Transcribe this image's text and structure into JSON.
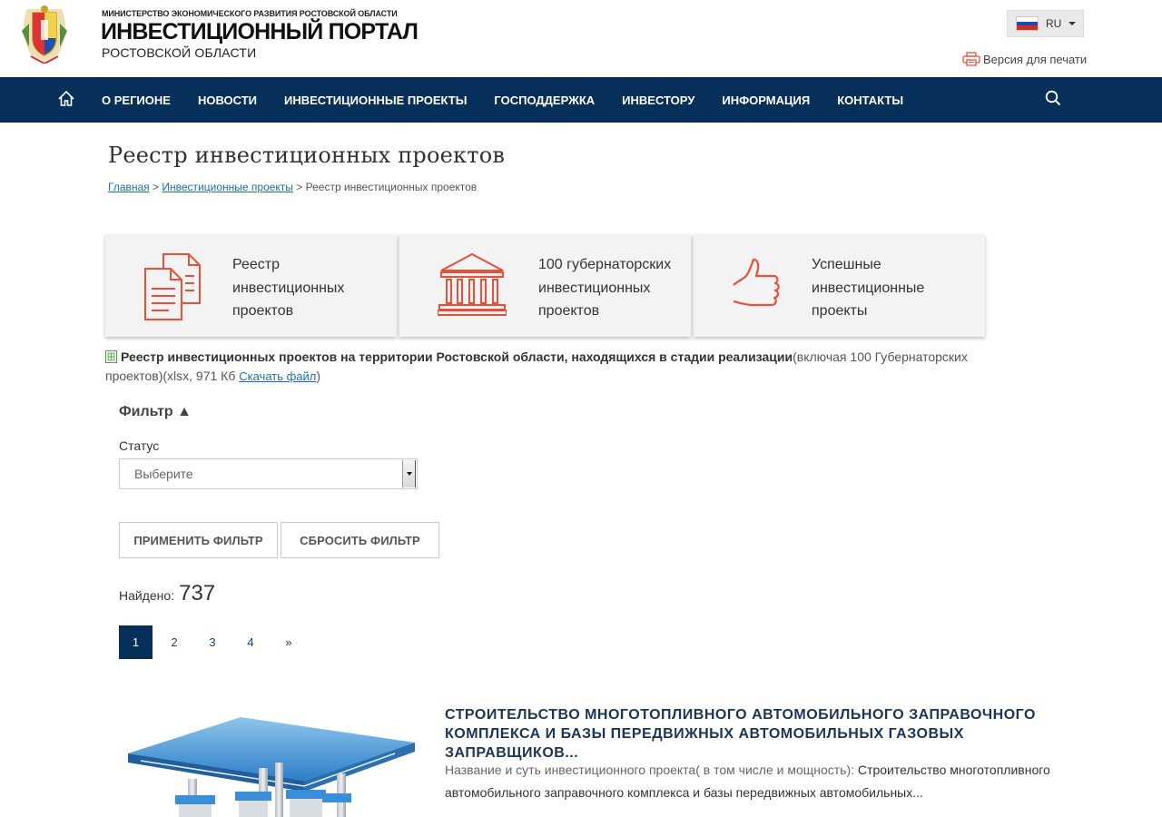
{
  "header": {
    "ministry": "МИНИСТЕРСТВО ЭКОНОМИЧЕСКОГО РАЗВИТИЯ РОСТОВСКОЙ ОБЛАСТИ",
    "title": "ИНВЕСТИЦИОННЫЙ ПОРТАЛ",
    "subtitle": "РОСТОВСКОЙ ОБЛАСТИ",
    "lang": "RU",
    "print_label": "Версия для печати"
  },
  "nav": {
    "items": [
      "О РЕГИОНЕ",
      "НОВОСТИ",
      "ИНВЕСТИЦИОННЫЕ ПРОЕКТЫ",
      "ГОСПОДДЕРЖКА",
      "ИНВЕСТОРУ",
      "ИНФОРМАЦИЯ",
      "КОНТАКТЫ"
    ]
  },
  "page": {
    "title": "Реестр инвестиционных проектов",
    "breadcrumb": {
      "home": "Главная",
      "sep1": ">",
      "section": "Инвестиционные проекты",
      "sep2": ">",
      "current": "Реестр инвестиционных проектов"
    }
  },
  "cards": [
    {
      "line1": "Реестр",
      "line2": "инвестиционных",
      "line3": "проектов",
      "icon": "documents-icon"
    },
    {
      "line1": "100 губернаторских",
      "line2": "инвестиционных",
      "line3": "проектов",
      "icon": "government-building-icon"
    },
    {
      "line1": "Успешные",
      "line2": "инвестиционные",
      "line3": "проекты",
      "icon": "thumbs-up-icon"
    }
  ],
  "file": {
    "bold": "Реестр инвестиционных проектов на территории Ростовской области, находящихся в стадии реализации",
    "rest": "(включая 100 Губернаторских проектов)(xlsx, 971 Кб",
    "link": "Скачать файл",
    "close": ")"
  },
  "filter": {
    "toggle": "Фильтр ▲",
    "status_label": "Статус",
    "status_value": "Выберите",
    "apply": "ПРИМЕНИТЬ ФИЛЬТР",
    "reset": "СБРОСИТЬ ФИЛЬТР"
  },
  "results": {
    "found_label": "Найдено:",
    "found_count": "737"
  },
  "pagination": {
    "pages": [
      "1",
      "2",
      "3",
      "4"
    ],
    "next": "»",
    "current": "1"
  },
  "project": {
    "title": "СТРОИТЕЛЬСТВО МНОГОТОПЛИВНОГО АВТОМОБИЛЬНОГО ЗАПРАВОЧНОГО КОМПЛЕКСА И БАЗЫ ПЕРЕДВИЖНЫХ АВТОМОБИЛЬНЫХ ГАЗОВЫХ ЗАПРАВЩИКОВ...",
    "desc_label": "Название и суть инвестиционного проекта( в том числе и мощность):",
    "desc_text": "Строительство многотопливного автомобильного заправочного комплекса и базы передвижных автомобильных..."
  },
  "colors": {
    "nav_bg": "#062f5a",
    "accent_red": "#e8503a",
    "link": "#1b6fb4"
  }
}
